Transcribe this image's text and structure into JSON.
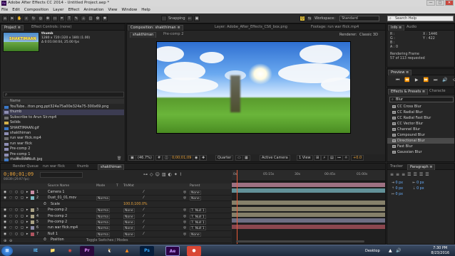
{
  "window": {
    "title": "Adobe After Effects CC 2014 - Untitled Project.aep *",
    "app_icon": "Ae",
    "controls": [
      "—",
      "□",
      "✕"
    ]
  },
  "menubar": [
    "File",
    "Edit",
    "Composition",
    "Layer",
    "Effect",
    "Animation",
    "View",
    "Window",
    "Help"
  ],
  "toolbar": {
    "snapping_label": "Snapping",
    "workspace_label": "Workspace:",
    "workspace_value": "Standard",
    "search_placeholder": "Search Help"
  },
  "project_panel": {
    "tabs": [
      "Project ≡",
      "Effect Controls: (none)"
    ],
    "selected_name": "thumb",
    "selected_info": [
      "1280 x 720 (320 x 180) (1.00)",
      "Δ 0:01:04:04, 25.00 fps"
    ],
    "thumb_logo": "SHAKTIMAAN",
    "search_placeholder": "ρ",
    "column_name": "Name",
    "items": [
      {
        "name": "YouTube...tton.png,ppt324a75a00e324a75-300x69.png",
        "type": "image",
        "selected": false
      },
      {
        "name": "thumb",
        "type": "comp",
        "selected": true
      },
      {
        "name": "Subscribe to Arun Sir.mp4",
        "type": "video",
        "selected": false
      },
      {
        "name": "Solids",
        "type": "folder",
        "selected": false
      },
      {
        "name": "SHAKTIMAAN.gif",
        "type": "image",
        "selected": false
      },
      {
        "name": "shakthiman",
        "type": "comp",
        "selected": false
      },
      {
        "name": "run war flick.mp4",
        "type": "video",
        "selected": false
      },
      {
        "name": "run war flick",
        "type": "comp",
        "selected": false
      },
      {
        "name": "Pre-comp 2",
        "type": "comp",
        "selected": false
      },
      {
        "name": "Pre-comp 1",
        "type": "comp",
        "selected": false
      },
      {
        "name": "maxresdefault.jpg",
        "type": "image",
        "selected": false
      }
    ],
    "footer_bpc": "8 bpc"
  },
  "composition_panel": {
    "tab_label": "Composition: shakthiman ≡",
    "layer_tab": "Layer: Adobe_After_Effects_CS6_box.png",
    "footage_tab": "Footage: run war flick.mp4",
    "breadcrumbs": [
      "shakthiman",
      "Pre-comp 2"
    ],
    "renderer_label": "Renderer:",
    "renderer_value": "Classic 3D",
    "zoom": "(46.7%)",
    "timecode": "0;00;01;09",
    "resolution": "Quarter",
    "camera": "Active Camera",
    "views": "1 View",
    "exposure": "+0.0"
  },
  "info_panel": {
    "tabs": [
      "Info ≡",
      "Audio"
    ],
    "r": "R :",
    "g": "G :",
    "b": "B :",
    "a": "A : 0",
    "x": "X : 1446",
    "y": "Y : 422",
    "status_1": "Rendering Frame",
    "status_2": "57 of 113 requested"
  },
  "preview_panel": {
    "tab": "Preview ≡"
  },
  "effects_panel": {
    "tabs": [
      "Effects & Presets ≡",
      "Characte"
    ],
    "search_value": "Blur",
    "items": [
      {
        "name": "CC Cross Blur",
        "selected": false
      },
      {
        "name": "CC Radial Blur",
        "selected": false
      },
      {
        "name": "CC Radial Fast Blur",
        "selected": false
      },
      {
        "name": "CC Vector Blur",
        "selected": false
      },
      {
        "name": "Channel Blur",
        "selected": false
      },
      {
        "name": "Compound Blur",
        "selected": false
      },
      {
        "name": "Directional Blur",
        "selected": true
      },
      {
        "name": "Fast Blur",
        "selected": false
      },
      {
        "name": "Gaussian Blur",
        "selected": false
      }
    ]
  },
  "timeline": {
    "tabs": [
      "Render Queue",
      "run war flick",
      "thumb",
      "shakthiman"
    ],
    "timecode": "0;00;01;09",
    "frames": "00039 (29.97 fps)",
    "columns": [
      "Source Name",
      "Mode",
      "T",
      "TrkMat",
      "Parent"
    ],
    "ruler_labels": [
      "0s",
      "05:15s",
      "30s",
      "00:45s",
      "01:00s"
    ],
    "layers": [
      {
        "num": "1",
        "name": "Camera 1",
        "mode": "",
        "trkmat": "",
        "parent": "None",
        "color": "#c98da5"
      },
      {
        "num": "2",
        "name": "Dust_01_01.mov",
        "mode": "Norma",
        "trkmat": "",
        "parent": "None",
        "color": "#7ab8c2"
      },
      {
        "num": "",
        "name": "Scale",
        "mode": "",
        "trkmat": "",
        "parent": "",
        "color": "",
        "value": "100.0,100.0%"
      },
      {
        "num": "3",
        "name": "Pre-comp 2",
        "mode": "Norma",
        "trkmat": "None",
        "parent": "7. Null 1",
        "color": "#a9a184"
      },
      {
        "num": "4",
        "name": "Pre-comp 2",
        "mode": "Norma",
        "trkmat": "None",
        "parent": "7. Null 1",
        "color": "#a9a184"
      },
      {
        "num": "5",
        "name": "Pre-comp 2",
        "mode": "Norma",
        "trkmat": "None",
        "parent": "7. Null 1",
        "color": "#a9a184"
      },
      {
        "num": "6",
        "name": "run war flick.mp4",
        "mode": "Norma",
        "trkmat": "None",
        "parent": "7. Null 1",
        "color": "#8a8aa6"
      },
      {
        "num": "7",
        "name": "Null 1",
        "mode": "Norma",
        "trkmat": "None",
        "parent": "None",
        "color": "#b05560"
      },
      {
        "num": "",
        "name": "Position",
        "mode": "",
        "trkmat": "",
        "parent": "",
        "color": ""
      }
    ],
    "footer_toggle": "Toggle Switches / Modes"
  },
  "paragraph_panel": {
    "tabs": [
      "Tracker",
      "Paragraph ≡"
    ],
    "fields": [
      "0 px",
      "0 px",
      "0 px",
      "0 px",
      "0 px"
    ]
  },
  "taskbar": {
    "apps": [
      "⊞",
      "IE",
      "📁",
      "◉",
      "Pr",
      "🐧",
      "▲",
      "Ps",
      "Ae",
      "●"
    ],
    "desktop_label": "Desktop",
    "time": "7:30 PM",
    "date": "8/23/2016"
  }
}
